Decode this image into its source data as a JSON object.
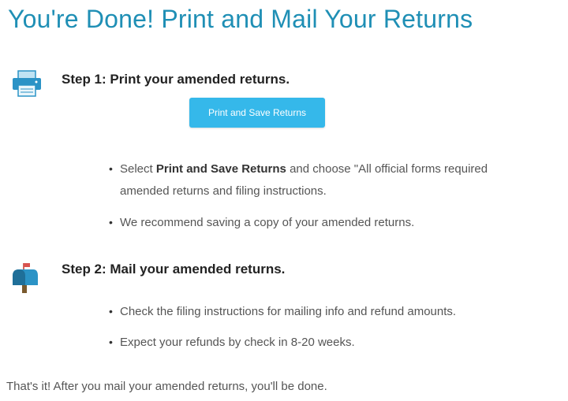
{
  "title": "You're Done! Print and Mail Your Returns",
  "step1": {
    "icon": "printer-icon",
    "heading": "Step 1: Print your amended returns.",
    "button_label": "Print and Save Returns",
    "bullets": [
      {
        "prefix": "Select ",
        "bold": "Print and Save Returns",
        "suffix": " and choose \"All official forms required",
        "continuation": "amended returns and filing instructions."
      },
      {
        "text": "We recommend saving a copy of your amended returns."
      }
    ]
  },
  "step2": {
    "icon": "mailbox-icon",
    "heading": "Step 2: Mail your amended returns.",
    "bullets": [
      {
        "text": "Check the filing instructions for mailing info and refund amounts."
      },
      {
        "text": "Expect your refunds by check in 8-20 weeks."
      }
    ]
  },
  "footer": "That's it! After you mail your amended returns, you'll be done.",
  "colors": {
    "title": "#1f8fb5",
    "button": "#35b8ea",
    "icon_blue": "#2b93c6"
  }
}
